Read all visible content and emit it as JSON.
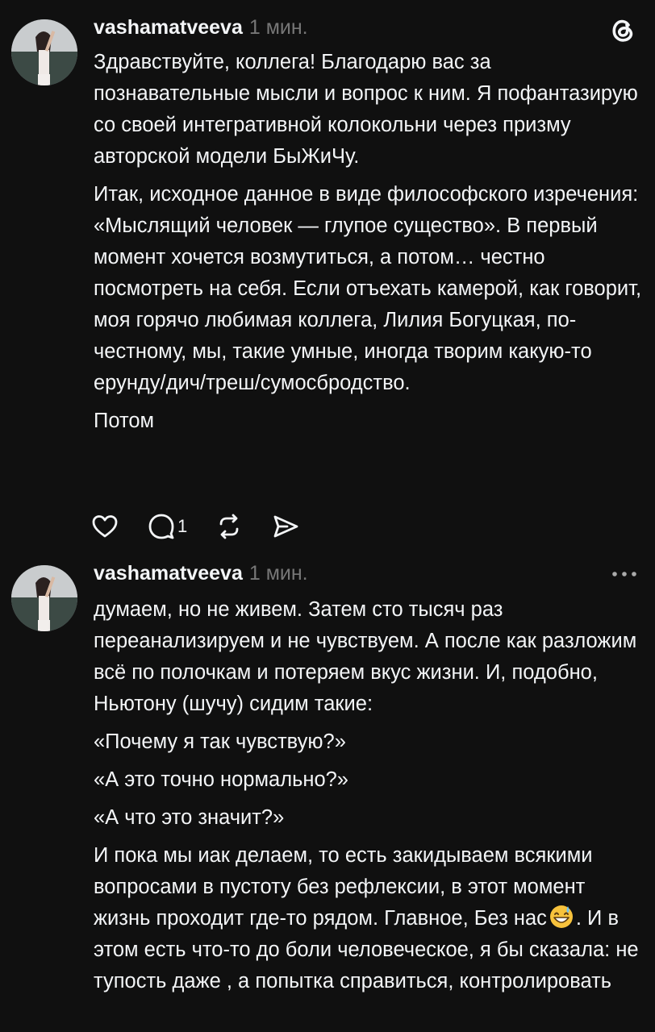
{
  "posts": [
    {
      "username": "vashamatveeva",
      "time": "1 мин.",
      "paragraphs": [
        "Здравствуйте, коллега! Благодарю вас за познавательные мысли и вопрос к ним. Я пофантазирую со своей интегративной колокольни через призму авторской модели БыЖиЧу.",
        "Итак, исходное данное в виде философского изречения: «Мыслящий человек — глупое существо». В первый момент хочется возмутиться, а потом… честно посмотреть на себя. Если отъехать камерой, как говорит, моя горячо любимая коллега, Лилия Богуцкая,  по-честному, мы, такие умные, иногда творим какую-то ерунду/дич/треш/сумосбродство.",
        "Потом"
      ],
      "reply_count": "1",
      "icons": [
        "threads-logo-icon",
        "heart-icon",
        "comment-icon",
        "repost-icon",
        "share-icon"
      ]
    },
    {
      "username": "vashamatveeva",
      "time": "1 мин.",
      "paragraphs": [
        "думаем, но не живем. Затем сто тысяч раз переанализируем и не чувствуем. А после как разложим всё по полочкам и потеряем вкус жизни. И, подобно, Ньютону (шучу) сидим такие:",
        "«Почему я так чувствую?»",
        "«А это точно нормально?»",
        "«А что это значит?»"
      ],
      "last_paragraph_before_emoji": "И пока мы иак делаем, то есть закидываем всякими вопросами в пустоту без рефлексии, в этот момент жизнь проходит где-то рядом. Главное, Без нас",
      "last_paragraph_after_emoji": ". И в этом есть что-то до боли человеческое, я бы сказала: не тупость даже , а попытка справиться, контролировать",
      "emoji": "grinning-face-with-sweat-emoji",
      "icons": [
        "more-options-icon"
      ]
    }
  ],
  "colors": {
    "background": "#101010",
    "text": "#f3f5f7",
    "muted": "#777777"
  }
}
